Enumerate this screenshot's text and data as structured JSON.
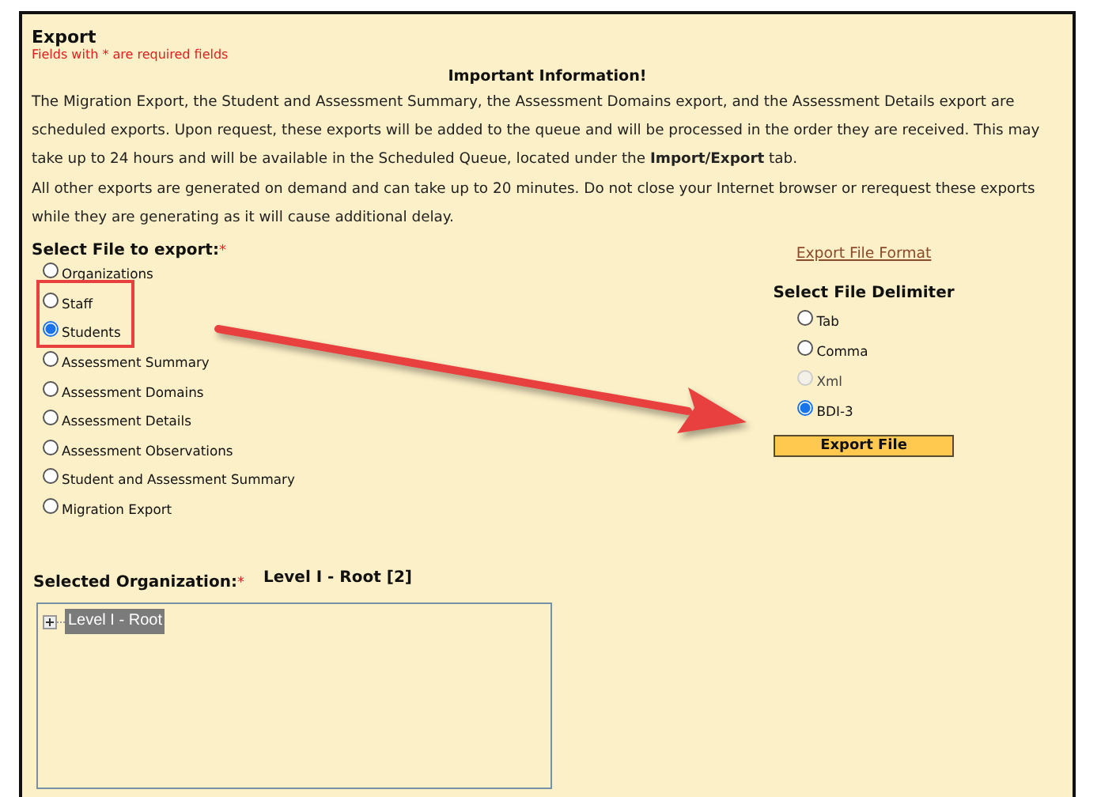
{
  "title": "Export",
  "required_note": "Fields with * are required fields",
  "info": {
    "heading": "Important Information!",
    "paragraphs": [
      "The Migration Export, the Student and Assessment Summary, the Assessment Domains export, and the Assessment Details export are scheduled exports. Upon request, these exports will be added to the queue and will be processed in the order they are received. This may take up to 24 hours and will be available in the Scheduled Queue, located under the **Import/Export** tab.",
      "All other exports are generated on demand and can take up to 20 minutes. Do not close your Internet browser or rerequest these exports while they are generating as it will cause additional delay."
    ]
  },
  "file_select": {
    "label": "Select File to export:",
    "required_mark": "*",
    "options": [
      {
        "label": "Organizations",
        "selected": false
      },
      {
        "label": "Staff",
        "selected": false
      },
      {
        "label": "Students",
        "selected": true
      },
      {
        "label": "Assessment Summary",
        "selected": false
      },
      {
        "label": "Assessment Domains",
        "selected": false
      },
      {
        "label": "Assessment Details",
        "selected": false
      },
      {
        "label": "Assessment Observations",
        "selected": false
      },
      {
        "label": "Student and Assessment Summary",
        "selected": false
      },
      {
        "label": "Migration Export",
        "selected": false
      }
    ]
  },
  "format_link": "Export File Format",
  "delimiter": {
    "label": "Select File Delimiter",
    "options": [
      {
        "label": "Tab",
        "selected": false,
        "disabled": false
      },
      {
        "label": "Comma",
        "selected": false,
        "disabled": false
      },
      {
        "label": "Xml",
        "selected": false,
        "disabled": true
      },
      {
        "label": "BDI-3",
        "selected": true,
        "disabled": false
      }
    ]
  },
  "export_button": "Export File",
  "organization": {
    "label": "Selected Organization:",
    "required_mark": "*",
    "value": "Level I - Root [2]",
    "tree": [
      {
        "label": "Level I - Root",
        "expanded": false,
        "selected": true
      }
    ]
  }
}
